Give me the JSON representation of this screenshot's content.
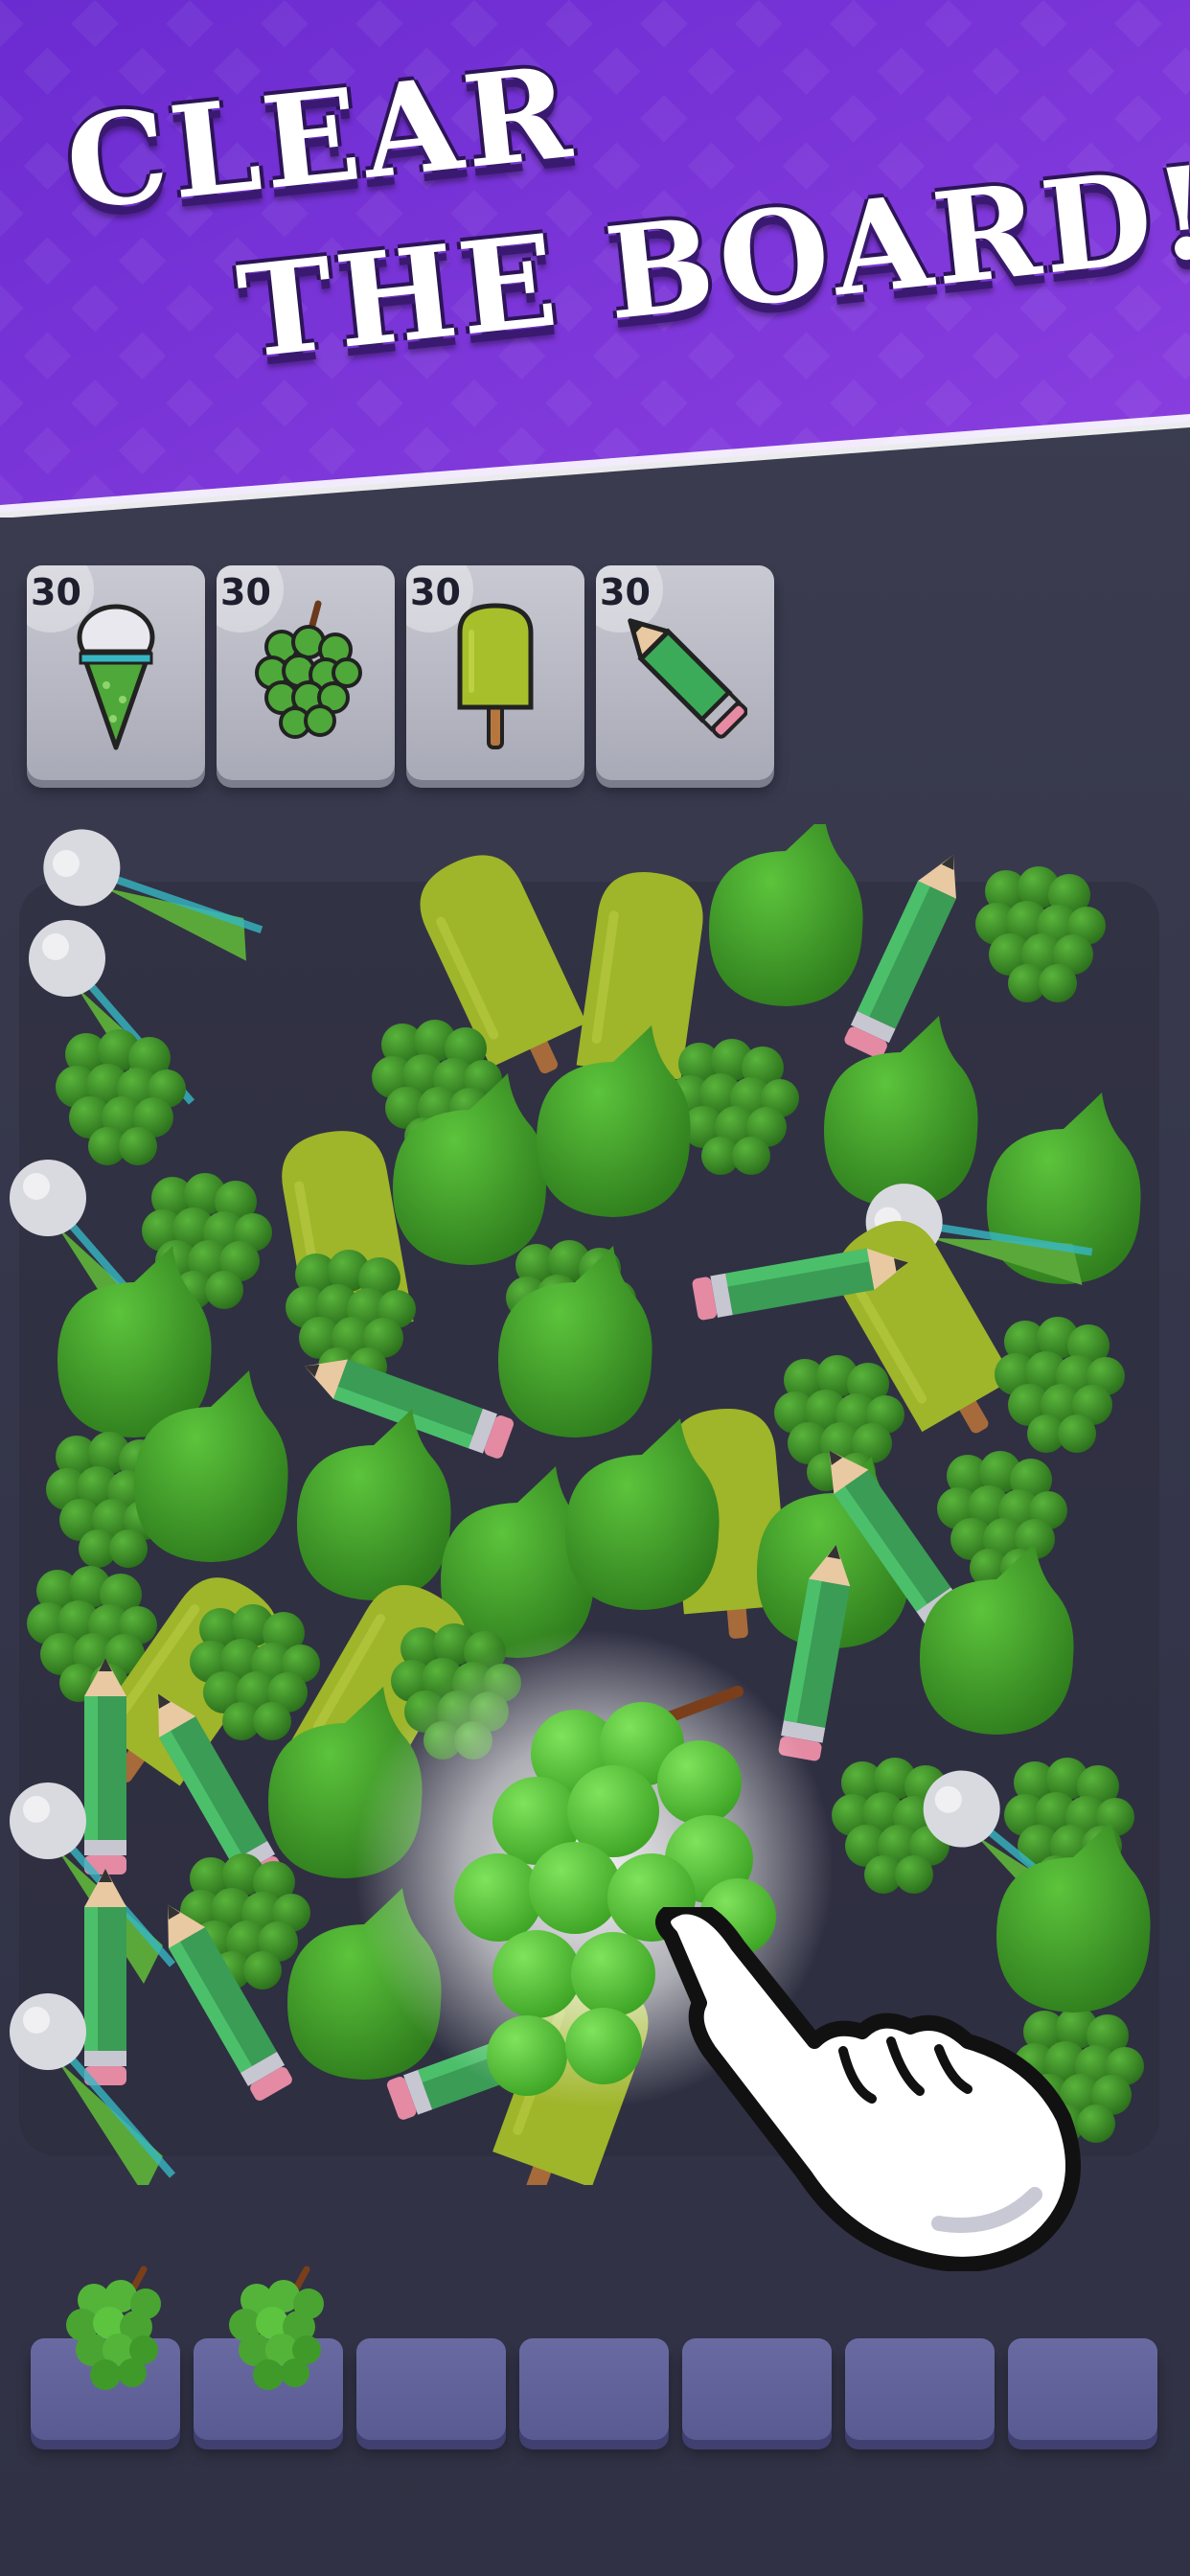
{
  "banner": {
    "line1": "CLEAR",
    "line2": "THE BOARD!"
  },
  "goals": [
    {
      "item": "ice-cream-cone",
      "count": "30"
    },
    {
      "item": "grapes",
      "count": "30"
    },
    {
      "item": "popsicle",
      "count": "30"
    },
    {
      "item": "pencil",
      "count": "30"
    }
  ],
  "board": {
    "highlighted_item": "grapes"
  },
  "tray": {
    "slot_count": 7,
    "filled": [
      "grapes",
      "grapes"
    ]
  },
  "colors": {
    "banner_purple": "#7a2fd6",
    "item_green": "#3f9c2a",
    "slot_purple": "#5f5f99"
  }
}
